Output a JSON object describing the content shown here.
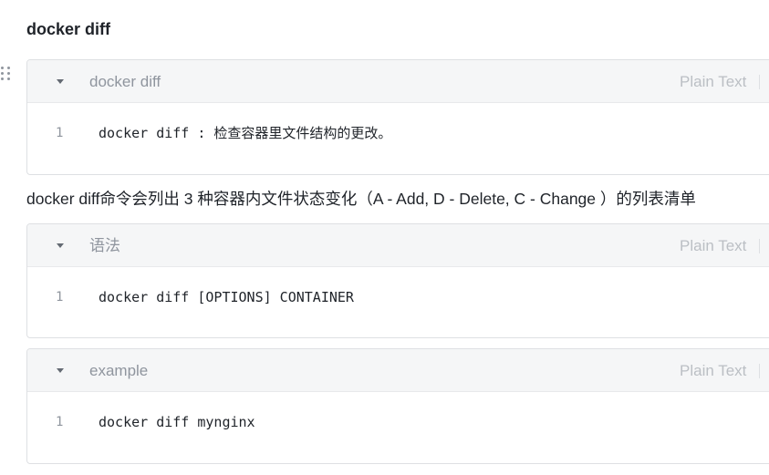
{
  "heading": "docker diff",
  "paragraph": "docker diff命令会列出 3 种容器内文件状态变化（A - Add, D - Delete, C - Change ）的列表清单",
  "icons": {
    "drag_handle": "drag-handle-icon",
    "collapse": "caret-down-icon"
  },
  "colors": {
    "text": "#1f2329",
    "muted": "#8f959e",
    "header_bg": "#f5f6f7",
    "border": "#dee0e3"
  },
  "code_blocks": [
    {
      "title": "docker diff",
      "language": "Plain Text",
      "lines": [
        {
          "number": "1",
          "text": "docker diff : 检查容器里文件结构的更改。"
        }
      ]
    },
    {
      "title": "语法",
      "language": "Plain Text",
      "lines": [
        {
          "number": "1",
          "text": "docker diff [OPTIONS] CONTAINER"
        }
      ]
    },
    {
      "title": "example",
      "language": "Plain Text",
      "lines": [
        {
          "number": "1",
          "text": "docker diff mynginx"
        }
      ]
    }
  ]
}
